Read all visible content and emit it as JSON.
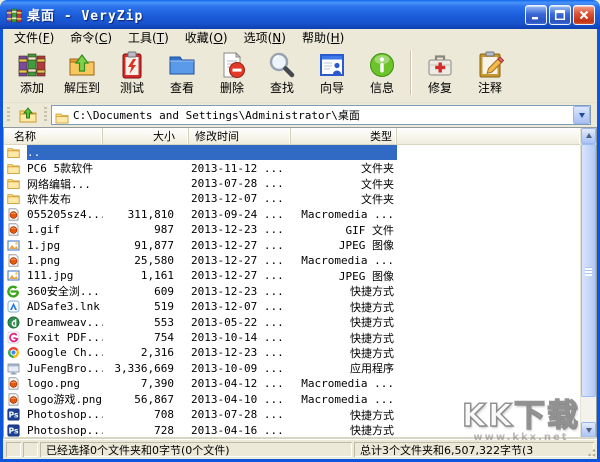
{
  "window": {
    "title": "桌面 - VeryZip"
  },
  "menu": {
    "items": [
      {
        "id": "file",
        "label": "文件(F)"
      },
      {
        "id": "command",
        "label": "命令(C)"
      },
      {
        "id": "tools",
        "label": "工具(T)"
      },
      {
        "id": "favorites",
        "label": "收藏(O)"
      },
      {
        "id": "options",
        "label": "选项(N)"
      },
      {
        "id": "help",
        "label": "帮助(H)"
      }
    ]
  },
  "toolbar": {
    "buttons": [
      {
        "id": "add",
        "label": "添加",
        "icon": "add-archive-icon"
      },
      {
        "id": "extract",
        "label": "解压到",
        "icon": "extract-icon"
      },
      {
        "id": "test",
        "label": "测试",
        "icon": "test-icon"
      },
      {
        "id": "view",
        "label": "查看",
        "icon": "view-icon"
      },
      {
        "id": "delete",
        "label": "删除",
        "icon": "delete-icon"
      },
      {
        "id": "find",
        "label": "查找",
        "icon": "find-icon"
      },
      {
        "id": "wizard",
        "label": "向导",
        "icon": "wizard-icon"
      },
      {
        "id": "info",
        "label": "信息",
        "icon": "info-icon"
      },
      {
        "separator": true
      },
      {
        "id": "repair",
        "label": "修复",
        "icon": "repair-icon"
      },
      {
        "id": "comment",
        "label": "注释",
        "icon": "comment-icon"
      }
    ]
  },
  "address": {
    "path": "C:\\Documents and Settings\\Administrator\\桌面"
  },
  "columns": [
    {
      "id": "name",
      "label": "名称"
    },
    {
      "id": "size",
      "label": "大小"
    },
    {
      "id": "mtime",
      "label": "修改时间"
    },
    {
      "id": "type",
      "label": "类型"
    }
  ],
  "files": [
    {
      "name": "..",
      "icon": "folder-icon",
      "size": "",
      "mtime": "",
      "type": "",
      "selected": true
    },
    {
      "name": "PC6 5款软件",
      "icon": "folder-icon",
      "size": "",
      "mtime": "2013-11-12 ...",
      "type": "文件夹"
    },
    {
      "name": "网络编辑...",
      "icon": "folder-icon",
      "size": "",
      "mtime": "2013-07-28 ...",
      "type": "文件夹"
    },
    {
      "name": "软件发布",
      "icon": "folder-icon",
      "size": "",
      "mtime": "2013-12-07 ...",
      "type": "文件夹"
    },
    {
      "name": "055205sz4...",
      "icon": "flash-file-icon",
      "size": "311,810",
      "mtime": "2013-09-24 ...",
      "type": "Macromedia ..."
    },
    {
      "name": "1.gif",
      "icon": "flash-file-icon",
      "size": "987",
      "mtime": "2013-12-23 ...",
      "type": "GIF 文件"
    },
    {
      "name": "1.jpg",
      "icon": "image-file-icon",
      "size": "91,877",
      "mtime": "2013-12-27 ...",
      "type": "JPEG 图像"
    },
    {
      "name": "1.png",
      "icon": "flash-file-icon",
      "size": "25,580",
      "mtime": "2013-12-27 ...",
      "type": "Macromedia ..."
    },
    {
      "name": "111.jpg",
      "icon": "image-file-icon",
      "size": "1,161",
      "mtime": "2013-12-27 ...",
      "type": "JPEG 图像"
    },
    {
      "name": "360安全浏...",
      "icon": "browser360-icon",
      "size": "609",
      "mtime": "2013-12-23 ...",
      "type": "快捷方式"
    },
    {
      "name": "ADSafe3.lnk",
      "icon": "adsafe-icon",
      "size": "519",
      "mtime": "2013-12-07 ...",
      "type": "快捷方式"
    },
    {
      "name": "Dreamweav...",
      "icon": "dreamweaver-icon",
      "size": "553",
      "mtime": "2013-05-22 ...",
      "type": "快捷方式"
    },
    {
      "name": "Foxit PDF...",
      "icon": "foxit-icon",
      "size": "754",
      "mtime": "2013-10-14 ...",
      "type": "快捷方式"
    },
    {
      "name": "Google Ch...",
      "icon": "chrome-icon",
      "size": "2,316",
      "mtime": "2013-12-23 ...",
      "type": "快捷方式"
    },
    {
      "name": "JuFengBro...",
      "icon": "program-icon",
      "size": "3,336,669",
      "mtime": "2013-10-09 ...",
      "type": "应用程序"
    },
    {
      "name": "logo.png",
      "icon": "flash-file-icon",
      "size": "7,390",
      "mtime": "2013-04-12 ...",
      "type": "Macromedia ..."
    },
    {
      "name": "logo游戏.png",
      "icon": "flash-file-icon",
      "size": "56,867",
      "mtime": "2013-04-10 ...",
      "type": "Macromedia ..."
    },
    {
      "name": "Photoshop...",
      "icon": "photoshop-icon",
      "size": "708",
      "mtime": "2013-07-28 ...",
      "type": "快捷方式"
    },
    {
      "name": "Photoshop...",
      "icon": "photoshop-icon",
      "size": "728",
      "mtime": "2013-04-16 ...",
      "type": "快捷方式"
    }
  ],
  "status": {
    "left": "已经选择0个文件夹和0字节(0个文件)",
    "right": "总计3个文件夹和6,507,322字节(3"
  },
  "watermark": {
    "text": "KK下载",
    "sub": "www.kkx.net"
  },
  "colors": {
    "selection": "#316ac5",
    "titlebar_blue": "#1b5cd8",
    "chrome_bg": "#ece9d8"
  }
}
